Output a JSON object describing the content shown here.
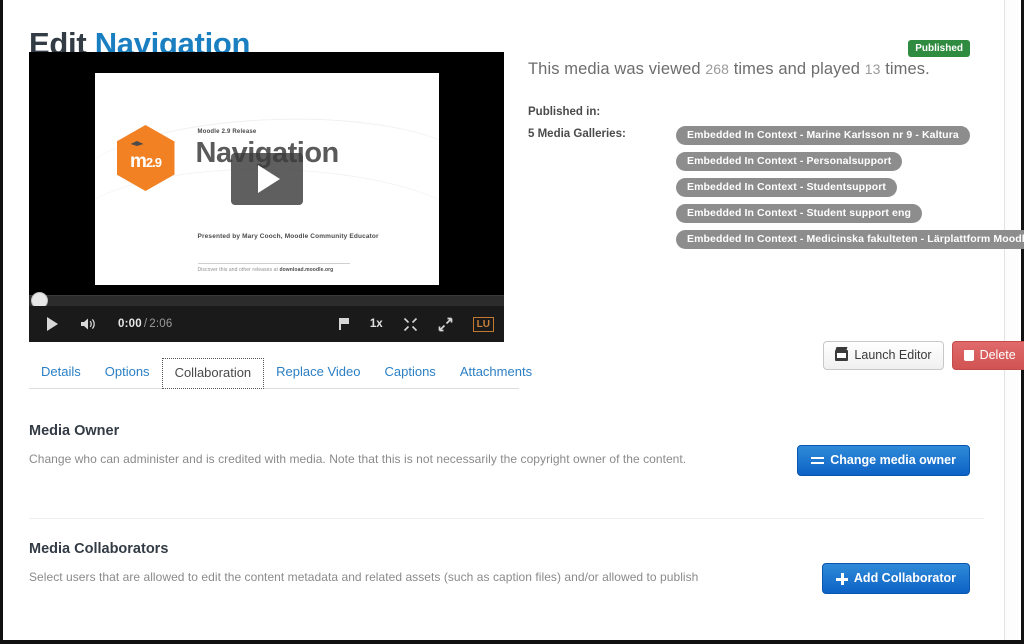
{
  "header": {
    "title_main": "Edit",
    "title_accent": "Navigation",
    "status_badge": "Published",
    "badge_color": "#2e8b3f"
  },
  "player": {
    "current_time": "0:00",
    "separator": "/",
    "duration": "2:06",
    "playback_rate": "1x",
    "quality_label": "LU",
    "slide": {
      "release_line": "Moodle 2.9 Release",
      "title": "Navigation",
      "logo_text": "m",
      "logo_version": "2.9",
      "presenter": "Presented by Mary Cooch, Moodle Community Educator",
      "footer_prefix": "Discover this and other releases at ",
      "footer_link": "download.moodle.org"
    }
  },
  "tabs": [
    {
      "label": "Details",
      "active": false
    },
    {
      "label": "Options",
      "active": false
    },
    {
      "label": "Collaboration",
      "active": true
    },
    {
      "label": "Replace Video",
      "active": false
    },
    {
      "label": "Captions",
      "active": false
    },
    {
      "label": "Attachments",
      "active": false
    }
  ],
  "stats": {
    "prefix": "This media was viewed ",
    "views": "268",
    "middle": " times and played ",
    "plays": "13",
    "suffix": " times."
  },
  "published_in": {
    "heading": "Published in:",
    "galleries_label": "5 Media Galleries:",
    "galleries": [
      "Embedded In Context - Marine Karlsson nr 9 - Kaltura",
      "Embedded In Context - Personalsupport",
      "Embedded In Context - Studentsupport",
      "Embedded In Context - Student support eng",
      "Embedded In Context - Medicinska fakulteten - Lärplattform Moodle"
    ]
  },
  "media_actions": {
    "launch_editor": "Launch Editor",
    "delete": "Delete"
  },
  "media_owner": {
    "title": "Media Owner",
    "description": "Change who can administer and is credited with media. Note that this is not necessarily the copyright owner of the content.",
    "button": "Change media owner"
  },
  "media_collaborators": {
    "title": "Media Collaborators",
    "description": "Select users that are allowed to edit the content metadata and related assets (such as caption files) and/or allowed to publish",
    "button": "Add Collaborator"
  }
}
